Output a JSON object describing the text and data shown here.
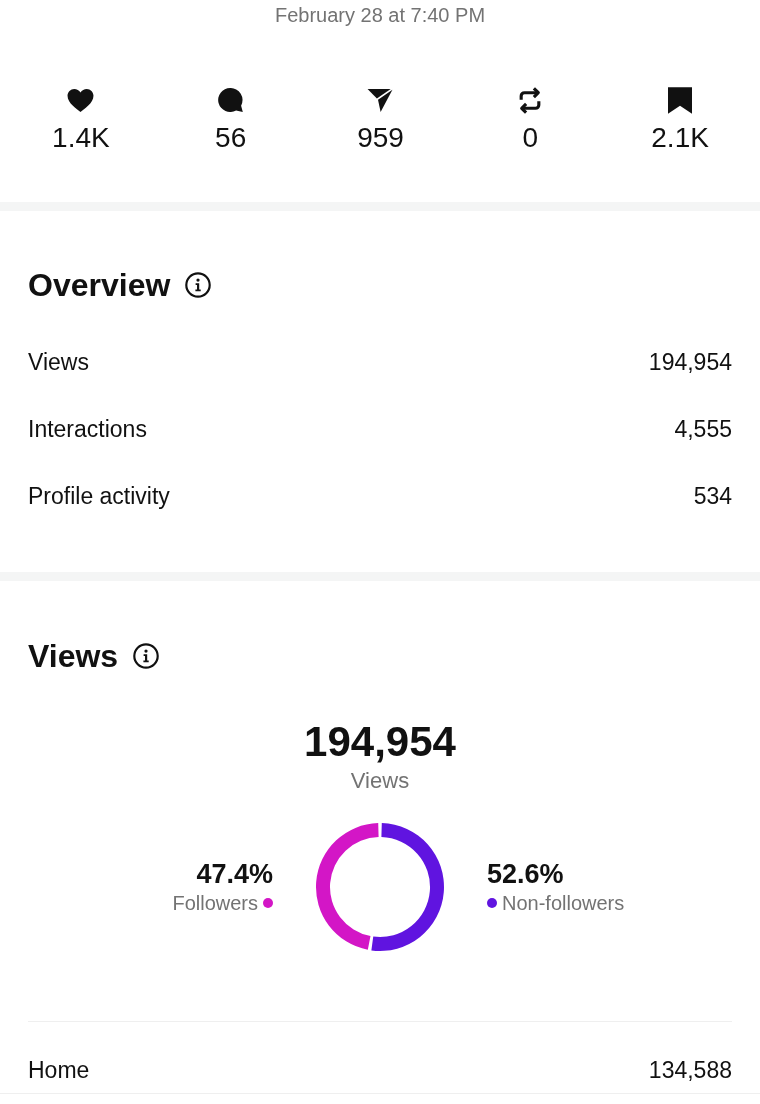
{
  "header": {
    "timestamp": "February 28 at 7:40 PM"
  },
  "stats": [
    {
      "kind": "likes",
      "value": "1.4K"
    },
    {
      "kind": "comments",
      "value": "56"
    },
    {
      "kind": "shares",
      "value": "959"
    },
    {
      "kind": "reposts",
      "value": "0"
    },
    {
      "kind": "saves",
      "value": "2.1K"
    }
  ],
  "overview": {
    "title": "Overview",
    "rows": [
      {
        "label": "Views",
        "value": "194,954"
      },
      {
        "label": "Interactions",
        "value": "4,555"
      },
      {
        "label": "Profile activity",
        "value": "534"
      }
    ]
  },
  "views": {
    "title": "Views",
    "total": "194,954",
    "total_label": "Views",
    "chart_data": {
      "type": "donut",
      "categories": [
        "Followers",
        "Non-followers"
      ],
      "values": [
        47.4,
        52.6
      ]
    },
    "legend": [
      {
        "share": "47.4%",
        "color": "#d316c6"
      },
      {
        "share": "52.6%",
        "color": "#6014e0"
      }
    ],
    "sources": [
      {
        "label": "Home",
        "value": "134,588"
      }
    ]
  }
}
